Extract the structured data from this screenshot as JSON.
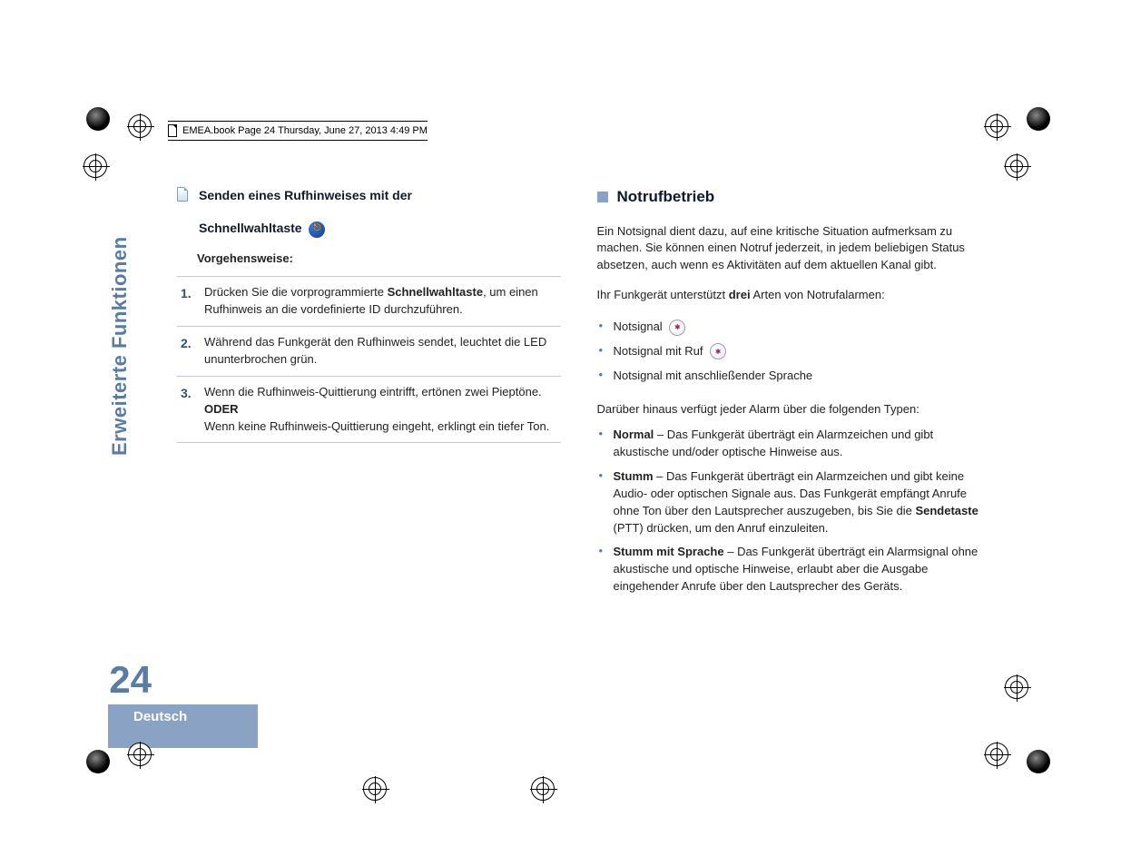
{
  "header": {
    "text": "EMEA.book  Page 24  Thursday, June 27, 2013  4:49 PM"
  },
  "left": {
    "section_title_line1": "Senden eines Rufhinweises mit der",
    "section_title_line2": "Schnellwahltaste",
    "procedure_label": "Vorgehensweise:",
    "steps": [
      {
        "n": "1.",
        "pre": "Drücken Sie die vorprogrammierte ",
        "bold": "Schnellwahltaste",
        "post": ", um einen Rufhinweis an die vordefinierte ID durchzuführen."
      },
      {
        "n": "2.",
        "text": "Während das Funkgerät den Rufhinweis sendet, leuchtet die LED ununterbrochen grün."
      },
      {
        "n": "3.",
        "pre": "Wenn die Rufhinweis-Quittierung eintrifft, ertönen zwei Pieptöne.",
        "or": "ODER",
        "post2": "Wenn keine Rufhinweis-Quittierung eingeht, erklingt ein tiefer Ton."
      }
    ]
  },
  "right": {
    "heading": "Notrufbetrieb",
    "intro": "Ein Notsignal dient dazu, auf eine kritische Situation aufmerksam zu machen. Sie können einen Notruf jederzeit, in jedem beliebigen Status absetzen, auch wenn es Aktivitäten auf dem aktuellen Kanal gibt.",
    "support_pre": "Ihr Funkgerät unterstützt ",
    "support_bold": "drei",
    "support_post": " Arten von Notrufalarmen:",
    "alarms": [
      {
        "label": "Notsignal",
        "icon": true
      },
      {
        "label": "Notsignal mit Ruf",
        "icon": true
      },
      {
        "label": "Notsignal mit anschließender Sprache",
        "icon": false
      }
    ],
    "types_intro": "Darüber hinaus verfügt jeder Alarm über die folgenden Typen:",
    "types": [
      {
        "bold": "Normal",
        "dash": " – ",
        "text": "Das Funkgerät überträgt ein Alarmzeichen und gibt akustische und/oder optische Hinweise aus."
      },
      {
        "bold": "Stumm",
        "dash": " – ",
        "text_pre": "Das Funkgerät überträgt ein Alarmzeichen und gibt keine Audio- oder optischen Signale aus. Das Funkgerät empfängt Anrufe ohne Ton über den Lautsprecher auszugeben, bis Sie die ",
        "text_bold": "Sendetaste",
        "text_post": " (PTT) drücken, um den Anruf einzuleiten."
      },
      {
        "bold": "Stumm mit Sprache",
        "dash": " – ",
        "text": "Das Funkgerät überträgt ein Alarmsignal ohne akustische und optische Hinweise, erlaubt aber die Ausgabe eingehender Anrufe über den Lautsprecher des Geräts."
      }
    ]
  },
  "side": {
    "tab": "Erweiterte Funktionen",
    "page": "24",
    "lang": "Deutsch"
  }
}
